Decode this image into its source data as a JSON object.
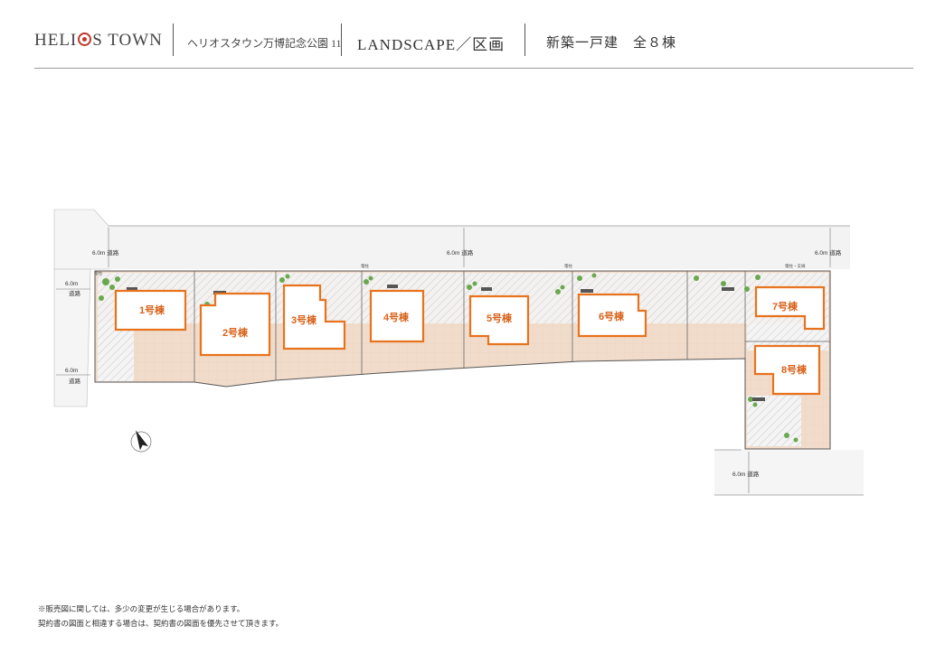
{
  "header": {
    "logo": "HELI",
    "logo_tail": "S TOWN",
    "project_name": "ヘリオスタウン万博記念公園 11",
    "section_title": "LANDSCAPE／区画",
    "unit_count": "新築一戸建　全８棟"
  },
  "roads": {
    "top_left": "6.0m 道路",
    "top_center": "6.0m 道路",
    "top_right": "6.0m 道路",
    "west_upper_width": "6.0m",
    "west_upper_label": "道路",
    "west_lower_width": "6.0m",
    "west_lower_label": "道路",
    "south": "6.0m 道路"
  },
  "poles": {
    "left": "電柱",
    "center_left": "電柱",
    "center_right": "電柱",
    "right": "電柱・支線"
  },
  "lots": [
    "1号棟",
    "2号棟",
    "3号棟",
    "4号棟",
    "5号棟",
    "6号棟",
    "7号棟",
    "8号棟"
  ],
  "colors": {
    "building_outline": "#e8731e",
    "building_label": "#d9621a",
    "paving": "#f1dccb",
    "gravel": "#d8d8d8",
    "greenery": "#6aa84f"
  },
  "compass": "north-arrow",
  "notes": {
    "line1": "※販売図に関しては、多少の変更が生じる場合があります。",
    "line2": "契約書の図面と相違する場合は、契約書の図面を優先させて頂きます。"
  }
}
